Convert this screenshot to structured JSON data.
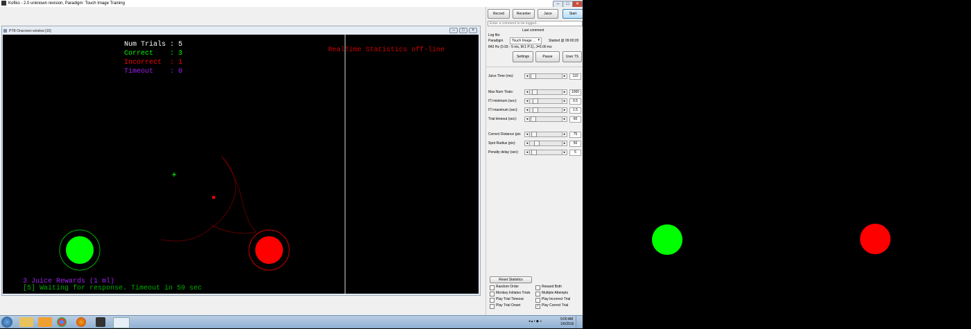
{
  "main_window": {
    "title": "Kofiko - 2.0 unknown revision, Paradigm: Touch Image Training",
    "controls": [
      "–",
      "□",
      "✕"
    ]
  },
  "ptb_window": {
    "title": "PTB Onscreen window [10]",
    "controls": [
      "–",
      "□",
      "×"
    ],
    "stats": {
      "num_trials": "Num Trials : 5",
      "correct": "Correct    : 3",
      "incorrect": "Incorrect  : 1",
      "timeout": "Timeout    : 0"
    },
    "realtime": "RealTime Statistics off-line",
    "juice_rewards": "3 Juice Rewards (1 ml)",
    "waiting": "[5] Waiting for response. Timeout in 59 sec",
    "colors": {
      "correct": "#00ff00",
      "incorrect": "#ff0000",
      "timeout": "#a020f0",
      "text": "#ffffff",
      "status": "#00b000"
    }
  },
  "control_panel": {
    "buttons": {
      "record": "Record",
      "recenter": "Recenter",
      "juice": "Juice",
      "start": "Start"
    },
    "comment_placeholder": "Enter a comment to be logged....",
    "last_comment_label": "Last comment",
    "log_file_label": "Log file:",
    "paradigm_label": "Paradigm",
    "paradigm_value": "Touch Image ...",
    "started": "Started @ 09:00:20",
    "rate": "843 Hz (0.93 - 5 ms, M:1 P:1),  J=0.00 ms",
    "settings": "Settings",
    "pause": "Pause",
    "user_ts": "User TS",
    "params": [
      {
        "label": "Juice Time (ms):",
        "value": "110"
      },
      {
        "label": "Max Num Trials:",
        "value": "1000"
      },
      {
        "label": "ITI minimum (sec):",
        "value": "0.5"
      },
      {
        "label": "ITI maximum (sec):",
        "value": "1.5"
      },
      {
        "label": "Trial timeout (sec):",
        "value": "60"
      },
      {
        "label": "Correct Distance (pix",
        "value": "75"
      },
      {
        "label": "Spot Radius (pix):",
        "value": "50"
      },
      {
        "label": "Penalty delay (sec):",
        "value": "5"
      }
    ],
    "reset_statistics": "Reset Statistics",
    "checkboxes": [
      {
        "label": "Random Order",
        "checked": false
      },
      {
        "label": "Reward Both",
        "checked": false
      },
      {
        "label": "Monkey Initiates Trials",
        "checked": false
      },
      {
        "label": "Multiple Attempts",
        "checked": false
      },
      {
        "label": "Play Trial Timeout",
        "checked": false
      },
      {
        "label": "Play Incorrect Trial",
        "checked": false
      },
      {
        "label": "Play Trial Onset",
        "checked": false
      },
      {
        "label": "Play Correct Trial",
        "checked": true
      }
    ]
  },
  "taskbar": {
    "time": "9:00 AM",
    "date": "1/6/2016",
    "icons": [
      "start-orb-icon",
      "file-explorer-icon",
      "media-player-icon",
      "chrome-icon",
      "firefox-icon",
      "inkscape-icon",
      "matlab-icon"
    ]
  },
  "right_display": {
    "colors": {
      "green": "#00ff00",
      "red": "#ff0000"
    }
  }
}
